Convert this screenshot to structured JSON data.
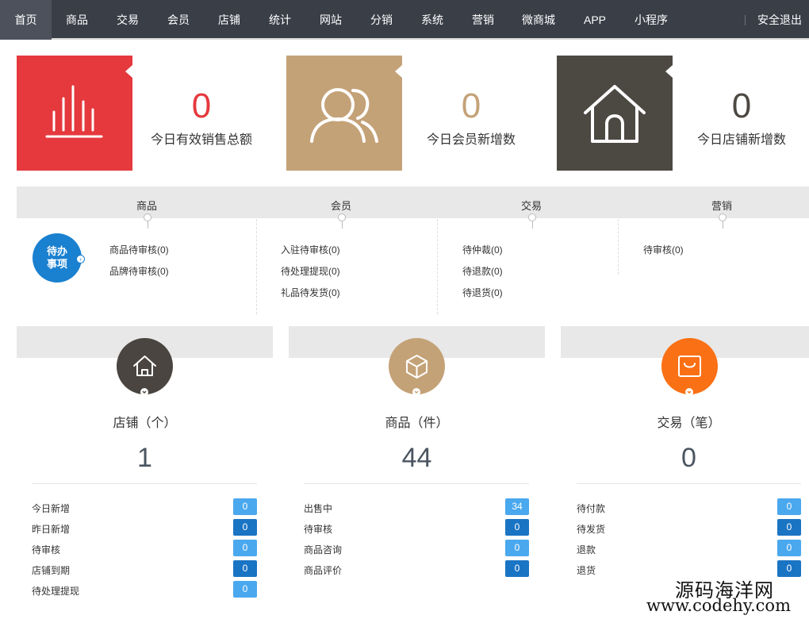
{
  "nav": {
    "items": [
      "首页",
      "商品",
      "交易",
      "会员",
      "店铺",
      "统计",
      "网站",
      "分销",
      "系统",
      "营销",
      "微商城",
      "APP",
      "小程序"
    ],
    "active": 0,
    "logout": "安全退出"
  },
  "stats": [
    {
      "value": "0",
      "label": "今日有效销售总额",
      "color": "#e5393e",
      "icon": "bar-chart-icon"
    },
    {
      "value": "0",
      "label": "今日会员新增数",
      "color": "#c4a277",
      "icon": "users-icon"
    },
    {
      "value": "0",
      "label": "今日店铺新增数",
      "color": "#4c4842",
      "icon": "house-icon"
    }
  ],
  "todo": {
    "badge": [
      "待办",
      "事项"
    ],
    "columns": [
      {
        "title": "商品",
        "items": [
          "商品待审核(0)",
          "品牌待审核(0)"
        ]
      },
      {
        "title": "会员",
        "items": [
          "入驻待审核(0)",
          "待处理提现(0)",
          "礼品待发货(0)"
        ]
      },
      {
        "title": "交易",
        "items": [
          "待仲裁(0)",
          "待退款(0)",
          "待退货(0)"
        ]
      },
      {
        "title": "营销",
        "items": [
          "待审核(0)"
        ]
      }
    ]
  },
  "panels": [
    {
      "title": "店铺（个）",
      "value": "1",
      "color": "#4a4540",
      "icon": "store-icon",
      "rows": [
        {
          "label": "今日新增",
          "count": "0",
          "tone": "light"
        },
        {
          "label": "昨日新增",
          "count": "0",
          "tone": "dark"
        },
        {
          "label": "待审核",
          "count": "0",
          "tone": "light"
        },
        {
          "label": "店铺到期",
          "count": "0",
          "tone": "dark"
        },
        {
          "label": "待处理提现",
          "count": "0",
          "tone": "light"
        }
      ]
    },
    {
      "title": "商品（件）",
      "value": "44",
      "color": "#c4a277",
      "icon": "box-icon",
      "rows": [
        {
          "label": "出售中",
          "count": "34",
          "tone": "light"
        },
        {
          "label": "待审核",
          "count": "0",
          "tone": "dark"
        },
        {
          "label": "商品咨询",
          "count": "0",
          "tone": "light"
        },
        {
          "label": "商品评价",
          "count": "0",
          "tone": "dark"
        }
      ]
    },
    {
      "title": "交易（笔）",
      "value": "0",
      "color": "#fa7014",
      "icon": "shopping-bag-icon",
      "rows": [
        {
          "label": "待付款",
          "count": "0",
          "tone": "light"
        },
        {
          "label": "待发货",
          "count": "0",
          "tone": "dark"
        },
        {
          "label": "退款",
          "count": "0",
          "tone": "light"
        },
        {
          "label": "退货",
          "count": "0",
          "tone": "dark"
        }
      ]
    }
  ],
  "watermark": {
    "cn": "源码海洋网",
    "en": "www.codehy.com"
  }
}
